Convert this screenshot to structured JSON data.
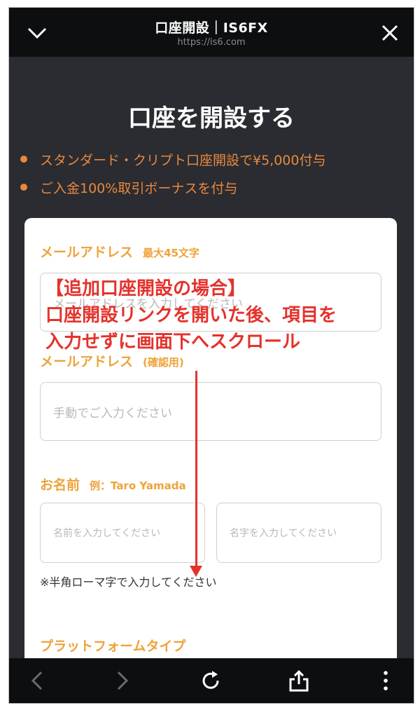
{
  "topbar": {
    "title": "口座開設｜IS6FX",
    "url": "https://is6.com"
  },
  "page": {
    "title": "口座を開設する",
    "bullets": [
      "スタンダード・クリプト口座開設で¥5,000付与",
      "ご入金100%取引ボーナスを付与"
    ]
  },
  "form": {
    "email_label": "メールアドレス",
    "email_sub": "最大45文字",
    "email_placeholder": "メールアドレスを入力してください",
    "email_confirm_label": "メールアドレス",
    "email_confirm_sub": "(確認用)",
    "email_confirm_placeholder": "手動でご入力ください",
    "name_label": "お名前",
    "name_sub": "例：Taro Yamada",
    "first_name_placeholder": "名前を入力してください",
    "last_name_placeholder": "名字を入力してください",
    "name_hint": "※半角ローマ字で入力してください",
    "platform_label": "プラットフォームタイプ"
  },
  "annotation": {
    "line1": "【追加口座開設の場合】",
    "line2": "口座開設リンクを開いた後、項目を",
    "line3": "入力せずに画面下へスクロール"
  },
  "colors": {
    "accent_orange": "#e9883f",
    "label_yellow": "#eea23a",
    "annotation_red": "#e4322b",
    "background_dark": "#2a2c31"
  },
  "icons": {
    "top_left": "chevron-down-icon",
    "top_right": "close-icon",
    "bottom": [
      "back-icon",
      "forward-icon",
      "reload-icon",
      "share-icon",
      "more-icon"
    ]
  }
}
